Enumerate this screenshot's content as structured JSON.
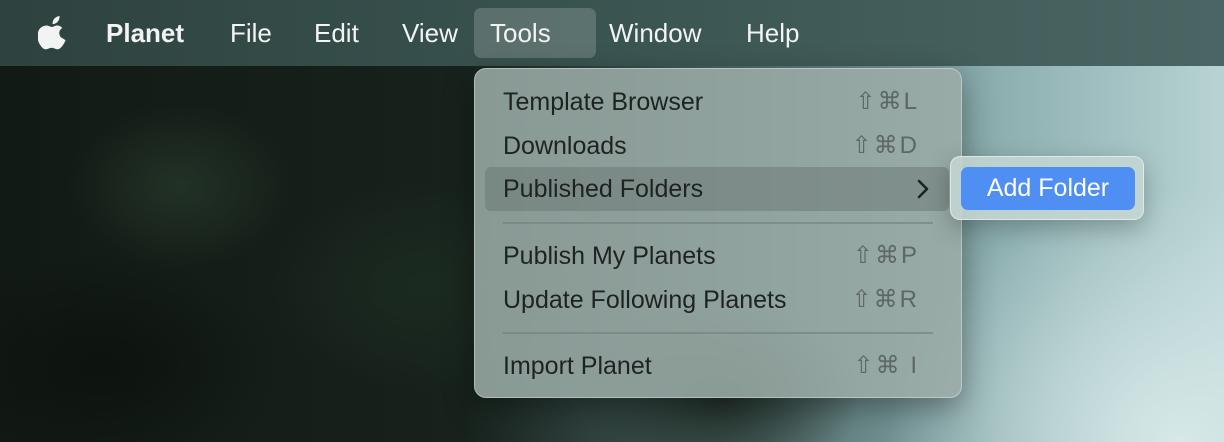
{
  "menubar": {
    "apple_icon": "apple-logo-icon",
    "app_name": "Planet",
    "items": [
      "File",
      "Edit",
      "View",
      "Tools",
      "Window",
      "Help"
    ],
    "active": "Tools"
  },
  "tools_menu": {
    "items": [
      {
        "label": "Template Browser",
        "shortcut": "⇧⌘L"
      },
      {
        "label": "Downloads",
        "shortcut": "⇧⌘D"
      },
      {
        "label": "Published Folders",
        "submenu_icon": "chevron-right-icon",
        "highlighted": true
      },
      {
        "label": "Publish My Planets",
        "shortcut": "⇧⌘P"
      },
      {
        "label": "Update Following Planets",
        "shortcut": "⇧⌘R"
      },
      {
        "label": "Import Planet",
        "shortcut": "⇧⌘ I"
      }
    ]
  },
  "published_folders_submenu": {
    "items": [
      {
        "label": "Add Folder",
        "selected": true
      }
    ]
  },
  "colors": {
    "selection_blue": "#4f8ef3",
    "menubar": "#3a5451"
  }
}
